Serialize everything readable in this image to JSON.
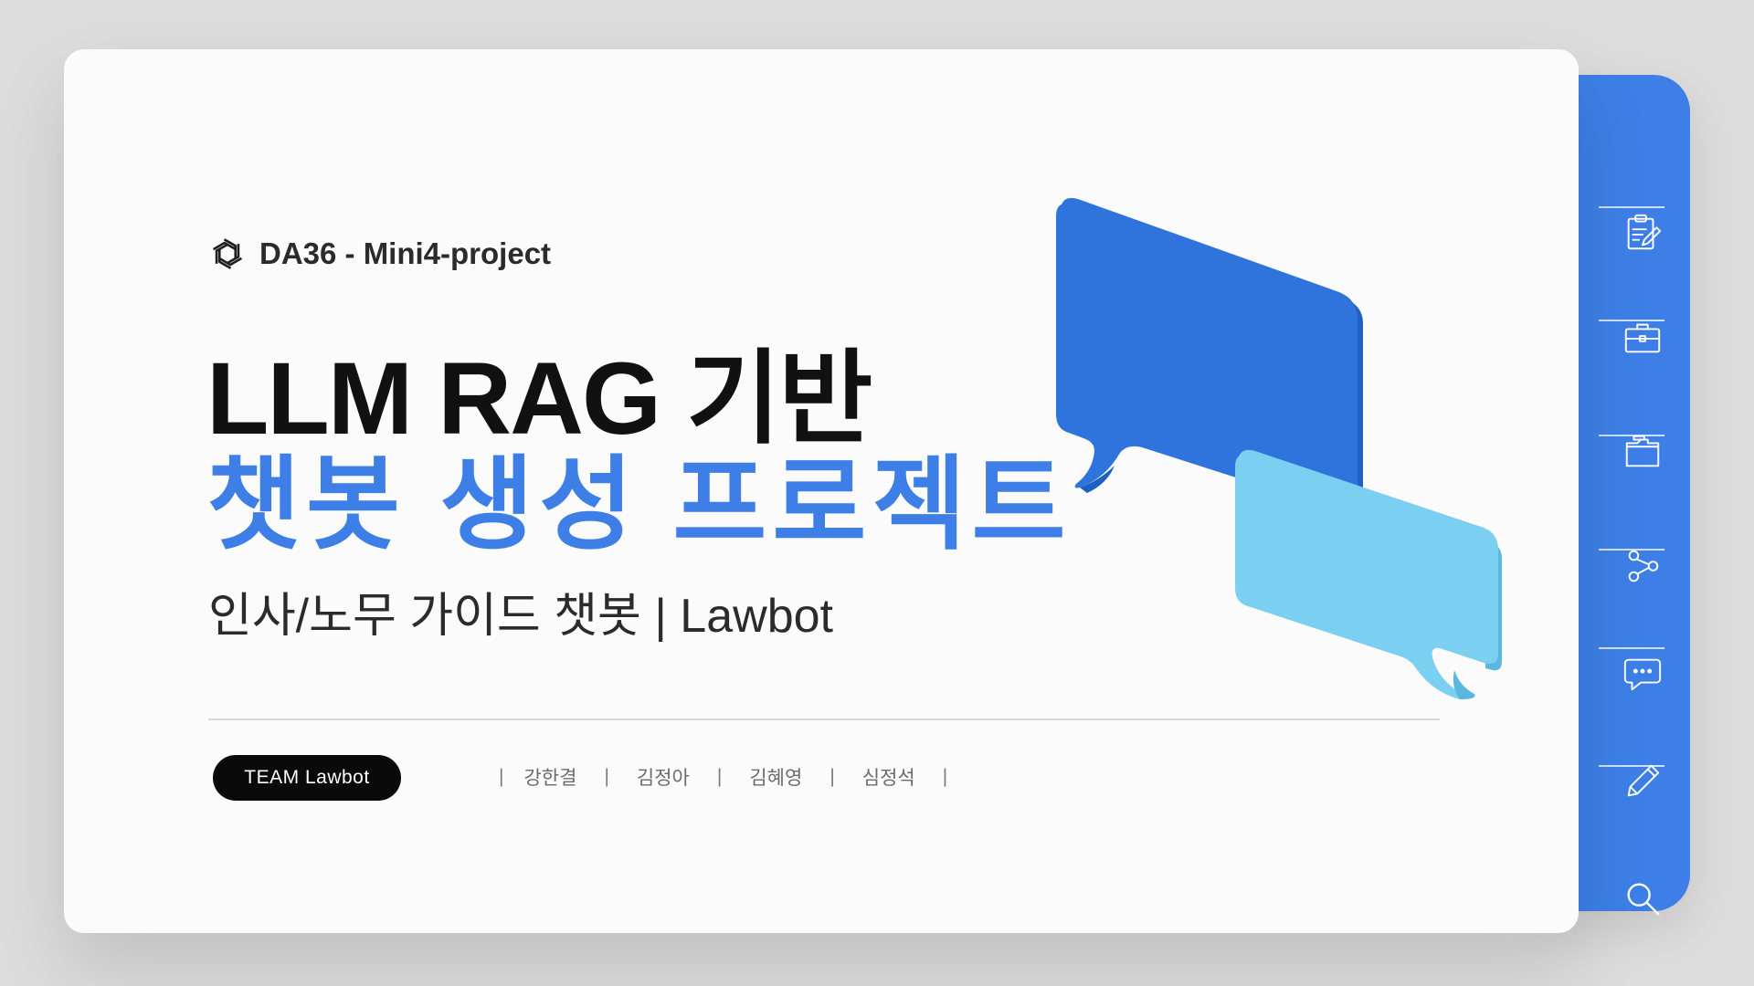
{
  "brand": {
    "logo_icon": "openai-knot-icon",
    "label": "DA36 - Mini4-project"
  },
  "title": {
    "line1": "LLM RAG 기반",
    "line2": "챗봇 생성 프로젝트"
  },
  "subtitle": "인사/노무 가이드 챗봇 | Lawbot",
  "team": {
    "label": "TEAM Lawbot",
    "members": [
      "강한결",
      "김정아",
      "김혜영",
      "심정석"
    ],
    "separator": "|"
  },
  "sidebar": {
    "items": [
      {
        "icon": "clipboard-edit-icon"
      },
      {
        "icon": "briefcase-icon"
      },
      {
        "icon": "folder-icon"
      },
      {
        "icon": "share-nodes-icon"
      },
      {
        "icon": "chat-bubble-icon"
      },
      {
        "icon": "pencil-icon"
      },
      {
        "icon": "search-icon"
      }
    ]
  },
  "colors": {
    "accent": "#3d7fe6",
    "bubble_dark": "#2f74dc",
    "bubble_light": "#78d2f0",
    "pill": "#0a0a0a",
    "background": "#dcdcdc",
    "card": "#fbfbfb"
  }
}
